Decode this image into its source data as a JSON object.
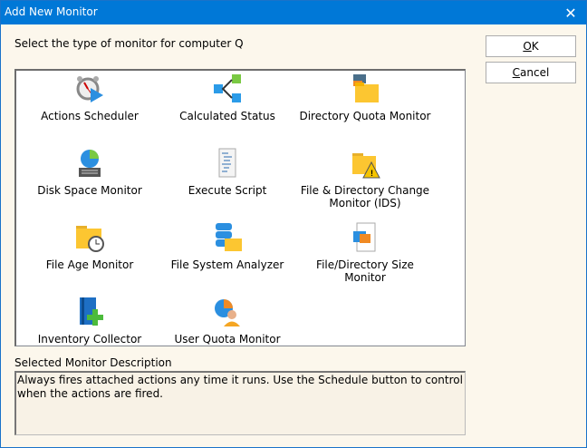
{
  "window": {
    "title": "Add New Monitor",
    "close_icon": "close-icon"
  },
  "prompt": "Select the type of monitor for computer Q",
  "buttons": {
    "ok_prefix": "O",
    "ok_rest": "K",
    "cancel_prefix": "C",
    "cancel_rest": "ancel"
  },
  "monitors": [
    {
      "label": "Actions Scheduler",
      "icon": "alarm-clock-play-icon"
    },
    {
      "label": "Calculated Status",
      "icon": "branch-nodes-icon"
    },
    {
      "label": "Directory Quota Monitor",
      "icon": "folder-quota-icon"
    },
    {
      "label": "Disk Space Monitor",
      "icon": "disk-pie-icon"
    },
    {
      "label": "Execute Script",
      "icon": "script-icon"
    },
    {
      "label": "File & Directory Change Monitor (IDS)",
      "icon": "folder-warning-icon"
    },
    {
      "label": "File Age Monitor",
      "icon": "folder-clock-icon"
    },
    {
      "label": "File System Analyzer",
      "icon": "database-folder-icon"
    },
    {
      "label": "File/Directory Size Monitor",
      "icon": "file-chart-icon"
    },
    {
      "label": "Inventory Collector",
      "icon": "book-plus-icon"
    },
    {
      "label": "User Quota Monitor",
      "icon": "user-pie-icon"
    }
  ],
  "description": {
    "label": "Selected Monitor Description",
    "text": "Always fires attached actions any time it runs.  Use the Schedule button to control when the actions are fired."
  }
}
